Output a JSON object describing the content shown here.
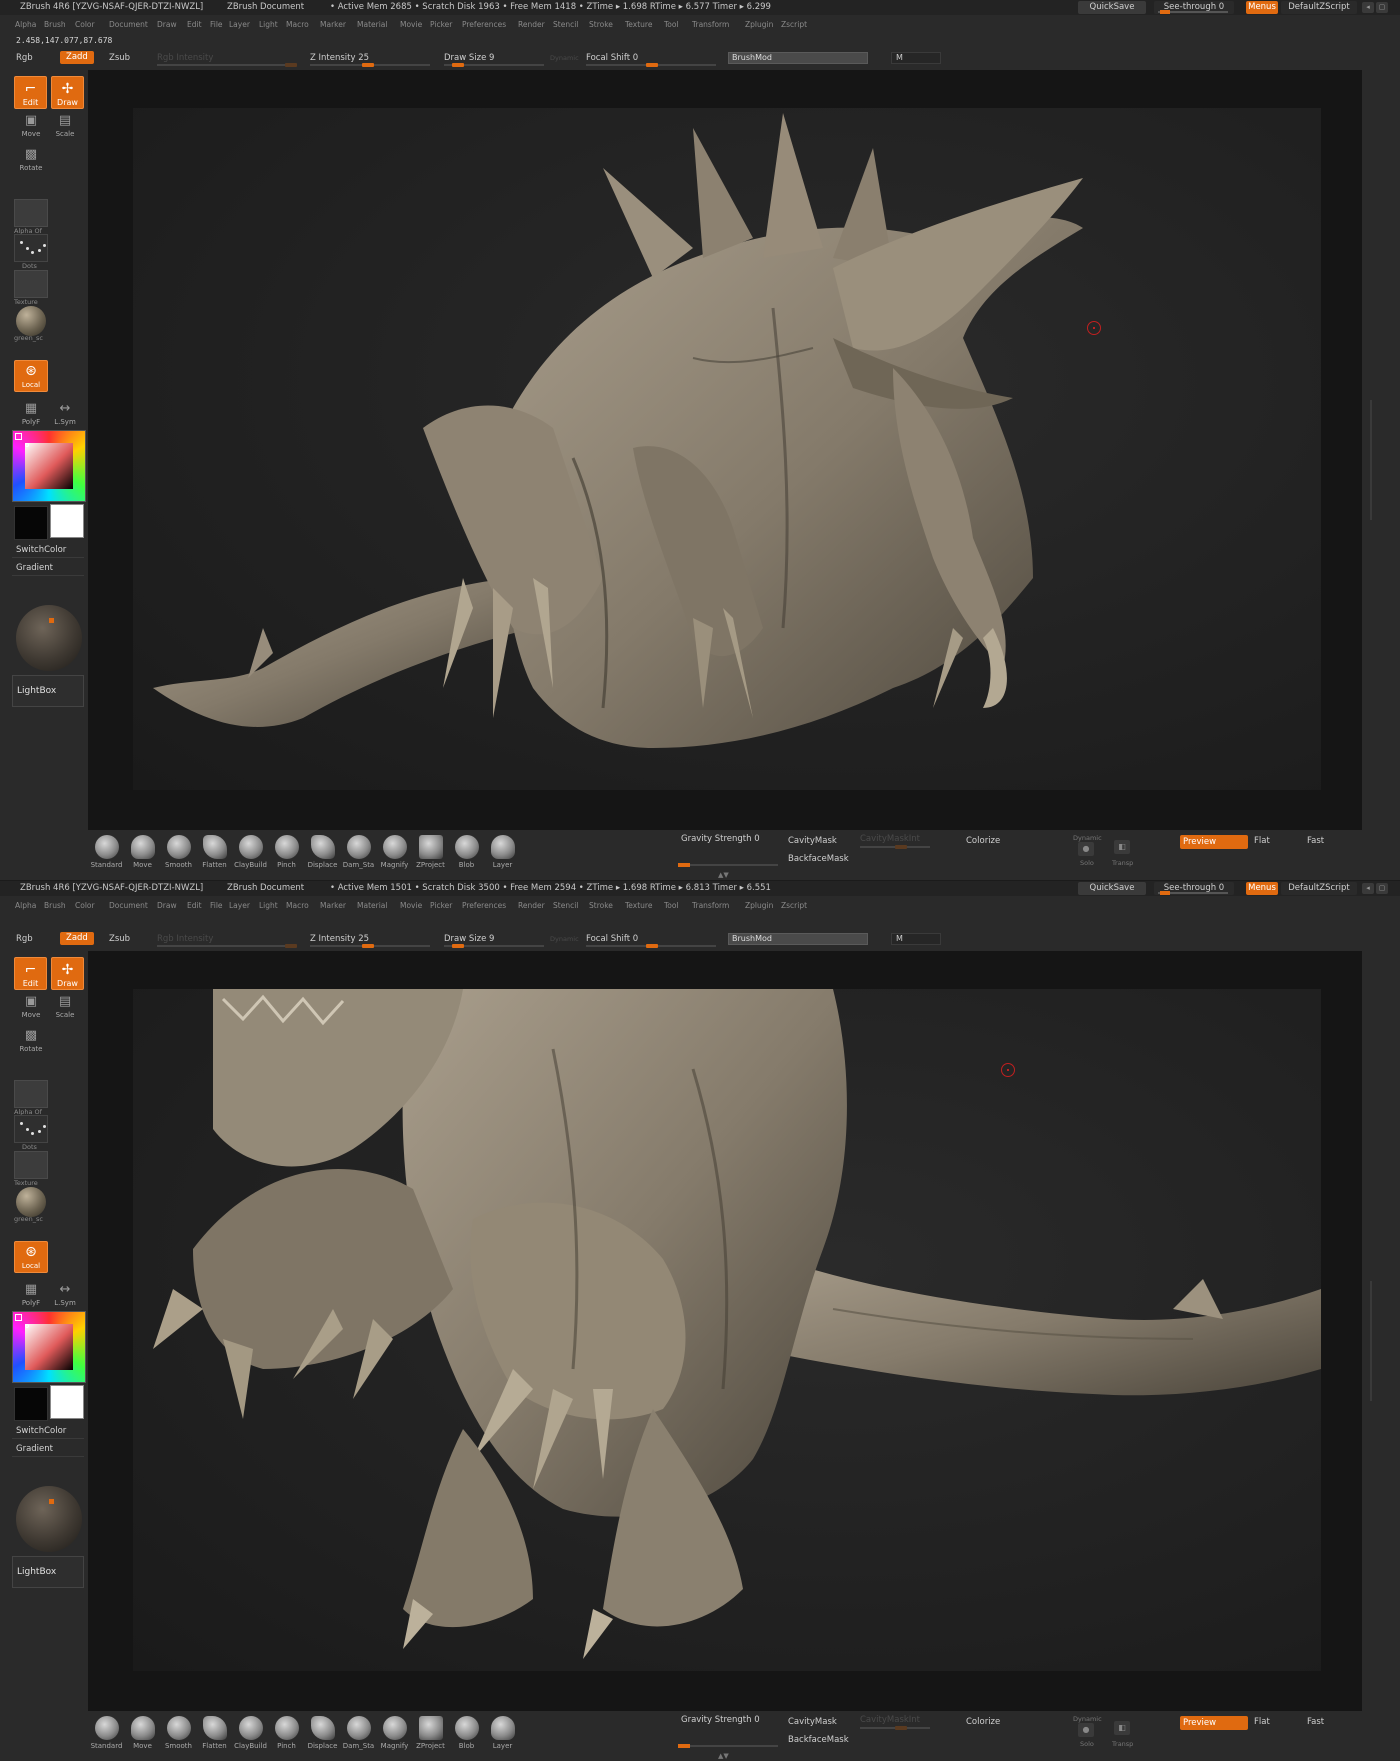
{
  "menus": [
    "Alpha",
    "Brush",
    "Color",
    "Document",
    "Draw",
    "Edit",
    "File",
    "Layer",
    "Light",
    "Macro",
    "Marker",
    "Material",
    "Movie",
    "Picker",
    "Preferences",
    "Render",
    "Stencil",
    "Stroke",
    "Texture",
    "Tool",
    "Transform",
    "Zplugin",
    "Zscript"
  ],
  "titlebar": {
    "quicksave": "QuickSave",
    "see_through": "See-through  0",
    "menus": "Menus",
    "default_zscript": "DefaultZScript"
  },
  "topbar": {
    "rgb": "Rgb",
    "zadd": "Zadd",
    "zsub": "Zsub",
    "rgb_intensity": "Rgb Intensity",
    "z_intensity": "Z Intensity 25",
    "draw_size": "Draw Size 9",
    "dynamic": "Dynamic",
    "focal_shift": "Focal Shift 0",
    "brushmod": "BrushMod",
    "m": "M"
  },
  "left_tray": {
    "edit": "Edit",
    "draw": "Draw",
    "move": "Move",
    "scale": "Scale",
    "rotate": "Rotate",
    "alpha": "Alpha  Of",
    "dots": "Dots",
    "texture": "Texture",
    "material": "green_sc",
    "local": "Local",
    "polyf": "PolyF",
    "lsym": "L.Sym",
    "switchcolor": "SwitchColor",
    "gradient": "Gradient",
    "lightbox": "LightBox"
  },
  "brushes": [
    "Standard",
    "Move",
    "Smooth",
    "Flatten",
    "ClayBuild",
    "Pinch",
    "Displace",
    "Dam_Sta",
    "Magnify",
    "ZProject",
    "Blob",
    "Layer"
  ],
  "bottom": {
    "gravity": "Gravity Strength 0",
    "cavitymask": "CavityMask",
    "cavitymaskint": "CavityMaskInt",
    "backfacemask": "BackfaceMask",
    "colorize": "Colorize",
    "dynamic": "Dynamic",
    "solo": "Solo",
    "transp": "Transp",
    "preview": "Preview",
    "flat": "Flat",
    "fast": "Fast"
  },
  "windows": [
    {
      "title": "ZBrush 4R6 [YZVG-NSAF-QJER-DTZI-NWZL]",
      "document": "ZBrush Document",
      "stats": "• Active Mem 2685 • Scratch Disk 1963 • Free Mem 1418 • ZTime ▸ 1.698 RTime ▸ 6.577 Timer ▸ 6.299",
      "coords": "2.458,147.077,87.678"
    },
    {
      "title": "ZBrush 4R6 [YZVG-NSAF-QJER-DTZI-NWZL]",
      "document": "ZBrush Document",
      "stats": "• Active Mem 1501 • Scratch Disk 3500 • Free Mem 2594 • ZTime ▸ 1.698 RTime ▸ 6.813 Timer ▸ 6.551",
      "coords": ""
    }
  ],
  "colors": {
    "accent": "#e06a10",
    "panel": "#2a2a2a",
    "canvas": "#1f1f1f",
    "sculpt": "#8a8072"
  }
}
